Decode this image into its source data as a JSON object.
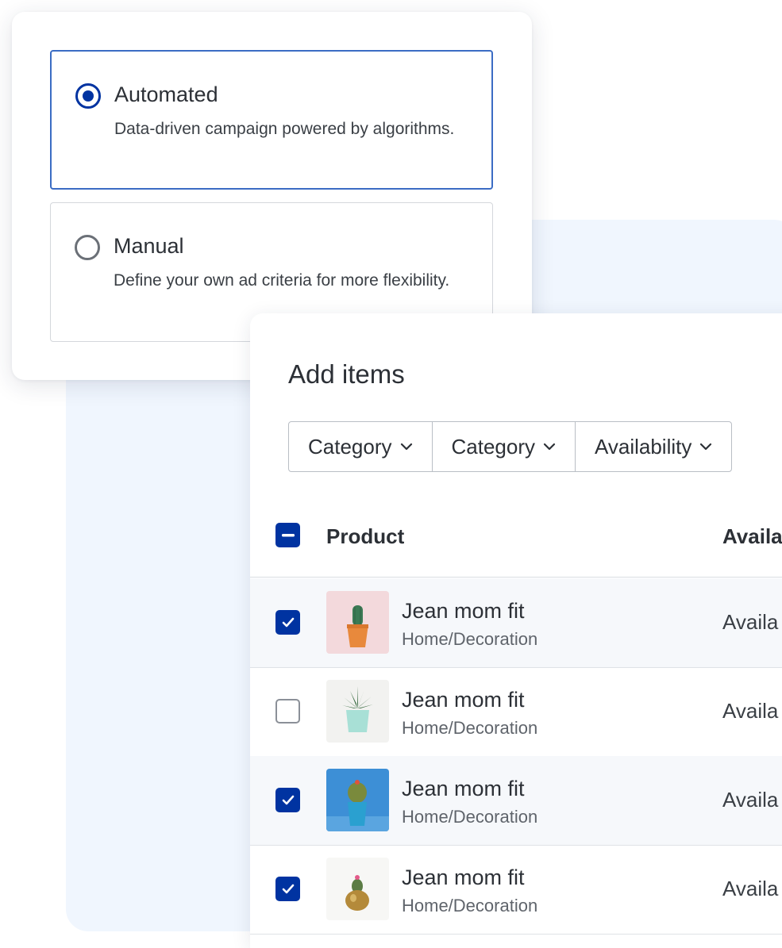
{
  "campaign_type": {
    "options": [
      {
        "title": "Automated",
        "description": "Data-driven campaign powered by algorithms.",
        "selected": true
      },
      {
        "title": "Manual",
        "description": "Define your own ad criteria for more flexibility.",
        "selected": false
      }
    ]
  },
  "add_items": {
    "title": "Add items",
    "filters": [
      "Category",
      "Category",
      "Availability"
    ],
    "columns": {
      "product": "Product",
      "availability": "Availa"
    },
    "rows": [
      {
        "name": "Jean mom fit",
        "category": "Home/Decoration",
        "availability": "Availa",
        "checked": true
      },
      {
        "name": "Jean mom fit",
        "category": "Home/Decoration",
        "availability": "Availa",
        "checked": false
      },
      {
        "name": "Jean mom fit",
        "category": "Home/Decoration",
        "availability": "Availa",
        "checked": true
      },
      {
        "name": "Jean mom fit",
        "category": "Home/Decoration",
        "availability": "Availa",
        "checked": true
      }
    ]
  },
  "colors": {
    "accent": "#0033a1",
    "selected_border": "#3b6cc4",
    "panel_bg": "#f0f6fe"
  }
}
